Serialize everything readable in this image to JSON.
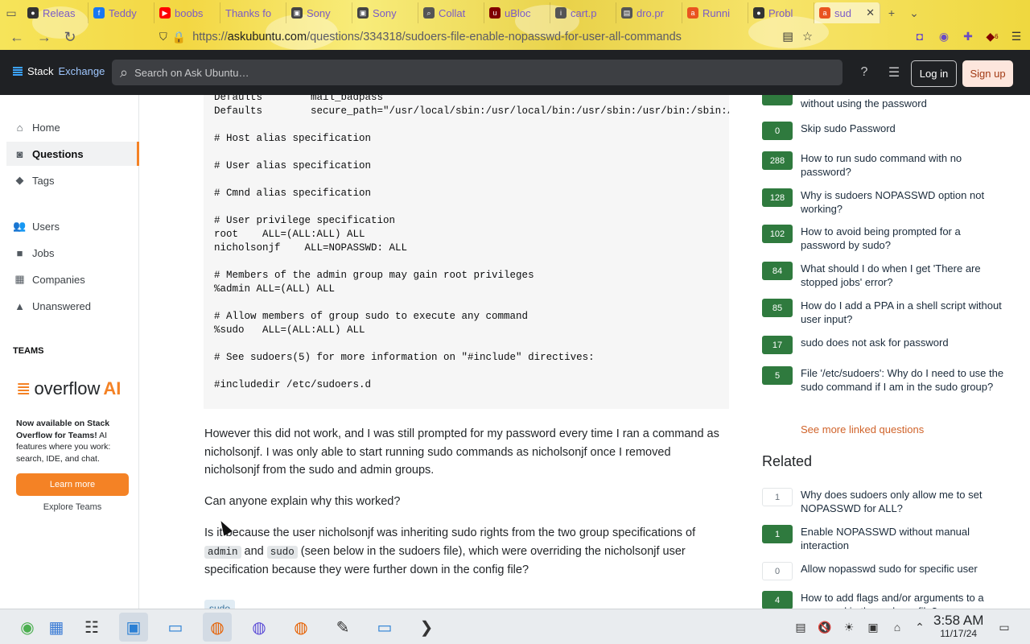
{
  "browser": {
    "tabs": [
      {
        "label": "Releas",
        "icon": "github-icon",
        "color": "#333333"
      },
      {
        "label": "Teddy",
        "icon": "facebook-icon",
        "color": "#1877f2"
      },
      {
        "label": "boobs",
        "icon": "youtube-icon",
        "color": "#ff0000"
      },
      {
        "label": "Thanks fo",
        "icon": "",
        "color": "#999999"
      },
      {
        "label": "Sony",
        "icon": "shop-icon",
        "color": "#444444"
      },
      {
        "label": "Sony",
        "icon": "shop-icon",
        "color": "#444444"
      },
      {
        "label": "Collat",
        "icon": "search-icon",
        "color": "#555555"
      },
      {
        "label": "uBloc",
        "icon": "ublock-icon",
        "color": "#800000"
      },
      {
        "label": "cart.p",
        "icon": "info-icon",
        "color": "#555555"
      },
      {
        "label": "dro.pr",
        "icon": "page-icon",
        "color": "#555555"
      },
      {
        "label": "Runni",
        "icon": "askubuntu-icon",
        "color": "#e95420"
      },
      {
        "label": "Probl",
        "icon": "github-icon",
        "color": "#333333"
      },
      {
        "label": "sud",
        "icon": "askubuntu-icon",
        "color": "#e95420",
        "active": true
      }
    ],
    "url_prefix": "https://",
    "url_host": "askubuntu.com",
    "url_path": "/questions/334318/sudoers-file-enable-nopasswd-for-user-all-commands",
    "extension_badge": "6"
  },
  "topbar": {
    "logo_a": "Stack",
    "logo_b": "Exchange",
    "search_placeholder": "Search on Ask Ubuntu…",
    "login_label": "Log in",
    "signup_label": "Sign up"
  },
  "leftnav": {
    "items": [
      {
        "label": "Home",
        "icon": "home-icon"
      },
      {
        "label": "Questions",
        "icon": "questions-icon",
        "active": true
      },
      {
        "label": "Tags",
        "icon": "tag-icon"
      },
      {
        "label": "Users",
        "icon": "users-icon"
      },
      {
        "label": "Jobs",
        "icon": "briefcase-icon"
      },
      {
        "label": "Companies",
        "icon": "buildings-icon"
      },
      {
        "label": "Unanswered",
        "icon": "unanswered-icon"
      }
    ],
    "teams_heading": "TEAMS",
    "overflow_word": "overflow",
    "ai_word": "AI",
    "teams_bold": "Now available on Stack Overflow for Teams!",
    "teams_text": " AI features where you work: search, IDE, and chat.",
    "learn_more": "Learn more",
    "explore_teams": "Explore Teams"
  },
  "main": {
    "code": "Defaults        mail_badpass\nDefaults        secure_path=\"/usr/local/sbin:/usr/local/bin:/usr/sbin:/usr/bin:/sbin:/bin:/snap/bin\"\n\n# Host alias specification\n\n# User alias specification\n\n# Cmnd alias specification\n\n# User privilege specification\nroot    ALL=(ALL:ALL) ALL\nnicholsonjf    ALL=NOPASSWD: ALL\n\n# Members of the admin group may gain root privileges\n%admin ALL=(ALL) ALL\n\n# Allow members of group sudo to execute any command\n%sudo   ALL=(ALL:ALL) ALL\n\n# See sudoers(5) for more information on \"#include\" directives:\n\n#includedir /etc/sudoers.d",
    "para1": "However this did not work, and I was still prompted for my password every time I ran a command as nicholsonjf. I was only able to start running sudo commands as nicholsonjf once I removed nicholsonjf from the sudo and admin groups.",
    "para2": "Can anyone explain why this worked?",
    "para3_a": "Is it because the user nicholsonjf was inheriting sudo rights from the two group specifications of ",
    "para3_code1": "admin",
    "para3_b": " and ",
    "para3_code2": "sudo",
    "para3_c": " (seen below in the sudoers file), which were overriding the nicholsonjf user specification because they were further down in the config file?",
    "tag": "sudo"
  },
  "rightcol": {
    "linked": [
      {
        "votes": "",
        "title": "without using the password",
        "green": true,
        "partial": true
      },
      {
        "votes": "0",
        "title": "Skip sudo Password",
        "green": true
      },
      {
        "votes": "288",
        "title": "How to run sudo command with no password?",
        "green": true
      },
      {
        "votes": "128",
        "title": "Why is sudoers NOPASSWD option not working?",
        "green": true
      },
      {
        "votes": "102",
        "title": "How to avoid being prompted for a password by sudo?",
        "green": true
      },
      {
        "votes": "84",
        "title": "What should I do when I get 'There are stopped jobs' error?",
        "green": true
      },
      {
        "votes": "85",
        "title": "How do I add a PPA in a shell script without user input?",
        "green": true
      },
      {
        "votes": "17",
        "title": "sudo does not ask for password",
        "green": true
      },
      {
        "votes": "5",
        "title": "File '/etc/sudoers': Why do I need to use the sudo command if I am in the sudo group?",
        "green": true
      }
    ],
    "see_more": "See more linked questions",
    "related_heading": "Related",
    "related": [
      {
        "votes": "1",
        "title": "Why does sudoers only allow me to set NOPASSWD for ALL?",
        "green": false
      },
      {
        "votes": "1",
        "title": "Enable NOPASSWD without manual interaction",
        "green": true
      },
      {
        "votes": "0",
        "title": "Allow nopasswd sudo for specific user",
        "green": false
      },
      {
        "votes": "4",
        "title": "How to add flags and/or arguments to a command in the sudoers file?",
        "green": true
      }
    ]
  },
  "taskbar": {
    "time": "3:58 AM",
    "date": "11/17/24"
  },
  "colors": {
    "accent": "#f48225",
    "green_vote": "#2f7a3e",
    "topbar": "#1f2124"
  }
}
